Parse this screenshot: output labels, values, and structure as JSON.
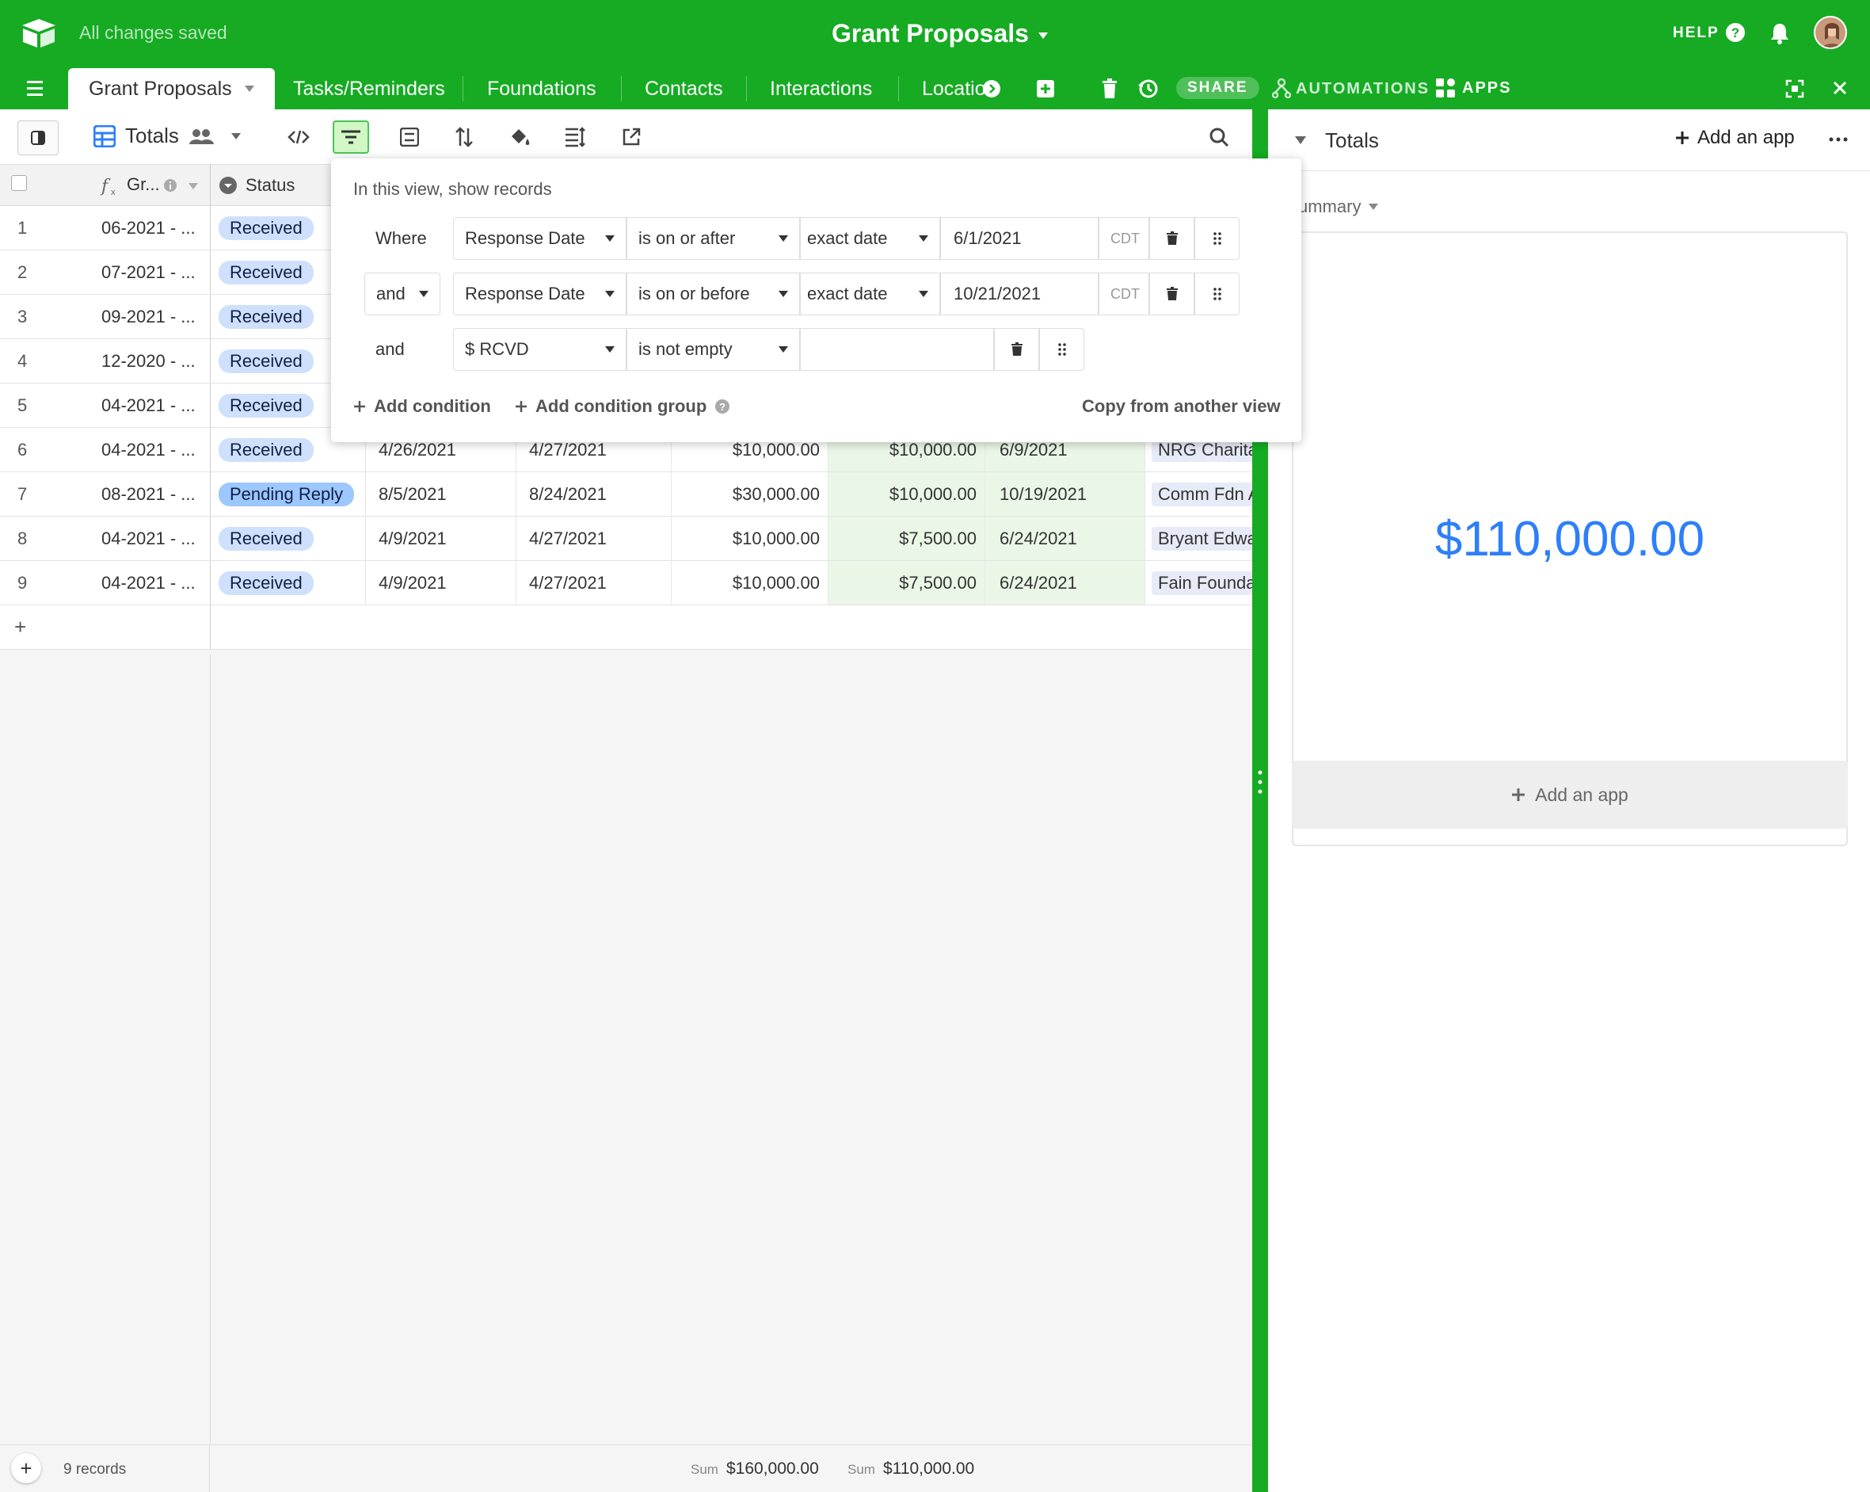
{
  "topbar": {
    "save_status": "All changes saved",
    "base_title": "Grant Proposals",
    "help_label": "HELP"
  },
  "tabs": [
    {
      "label": "Grant Proposals"
    },
    {
      "label": "Tasks/Reminders"
    },
    {
      "label": "Foundations"
    },
    {
      "label": "Contacts"
    },
    {
      "label": "Interactions"
    },
    {
      "label": "Locatio"
    }
  ],
  "tabbar": {
    "share_label": "SHARE",
    "automations_label": "AUTOMATIONS",
    "apps_label": "APPS"
  },
  "view": {
    "name": "Totals"
  },
  "grid": {
    "columns": [
      {
        "label": "Gr..."
      },
      {
        "label": "Status"
      }
    ],
    "rows": [
      {
        "num": "1",
        "name": "06-2021 - ...",
        "status": "Received",
        "c1": "",
        "c2": "",
        "c3": "",
        "c4": "",
        "c5": "",
        "c6": ""
      },
      {
        "num": "2",
        "name": "07-2021 - ...",
        "status": "Received",
        "c1": "",
        "c2": "",
        "c3": "",
        "c4": "",
        "c5": "",
        "c6": ""
      },
      {
        "num": "3",
        "name": "09-2021 - ...",
        "status": "Received",
        "c1": "",
        "c2": "",
        "c3": "",
        "c4": "",
        "c5": "",
        "c6": ""
      },
      {
        "num": "4",
        "name": "12-2020 - ...",
        "status": "Received",
        "c1": "",
        "c2": "",
        "c3": "",
        "c4": "",
        "c5": "",
        "c6": ""
      },
      {
        "num": "5",
        "name": "04-2021 - ...",
        "status": "Received",
        "c1": "",
        "c2": "",
        "c3": "",
        "c4": "",
        "c5": "",
        "c6": ""
      },
      {
        "num": "6",
        "name": "04-2021 - ...",
        "status": "Received",
        "c1": "4/26/2021",
        "c2": "4/27/2021",
        "c3": "$10,000.00",
        "c4": "$10,000.00",
        "c5": "6/9/2021",
        "c6": "NRG Charita"
      },
      {
        "num": "7",
        "name": "08-2021 - ...",
        "status": "Pending Reply",
        "c1": "8/5/2021",
        "c2": "8/24/2021",
        "c3": "$30,000.00",
        "c4": "$10,000.00",
        "c5": "10/19/2021",
        "c6": "Comm Fdn A"
      },
      {
        "num": "8",
        "name": "04-2021 - ...",
        "status": "Received",
        "c1": "4/9/2021",
        "c2": "4/27/2021",
        "c3": "$10,000.00",
        "c4": "$7,500.00",
        "c5": "6/24/2021",
        "c6": "Bryant Edwa"
      },
      {
        "num": "9",
        "name": "04-2021 - ...",
        "status": "Received",
        "c1": "4/9/2021",
        "c2": "4/27/2021",
        "c3": "$10,000.00",
        "c4": "$7,500.00",
        "c5": "6/24/2021",
        "c6": "Fain Founda"
      }
    ],
    "add_row": "+"
  },
  "footer": {
    "records": "9 records",
    "sum_label_1": "Sum",
    "sum_value_1": "$160,000.00",
    "sum_label_2": "Sum",
    "sum_value_2": "$110,000.00"
  },
  "filter": {
    "heading": "In this view, show records",
    "conditions": [
      {
        "conj": "Where",
        "field": "Response Date",
        "op": "is on or after",
        "mode": "exact date",
        "value": "6/1/2021",
        "tz": "CDT"
      },
      {
        "conj": "and",
        "field": "Response Date",
        "op": "is on or before",
        "mode": "exact date",
        "value": "10/21/2021",
        "tz": "CDT"
      },
      {
        "conj": "and",
        "field": "$ RCVD",
        "op": "is not empty",
        "mode": "",
        "value": "",
        "tz": ""
      }
    ],
    "add_condition": "Add condition",
    "add_group": "Add condition group",
    "copy": "Copy from another view"
  },
  "side": {
    "title": "Totals",
    "add_app": "Add an app",
    "summary_label": "ummary",
    "big_value": "$110,000.00",
    "add_app_bottom": "Add an app"
  },
  "colors": {
    "brand_green": "#16ab23",
    "accent_blue": "#2d7ff9"
  }
}
